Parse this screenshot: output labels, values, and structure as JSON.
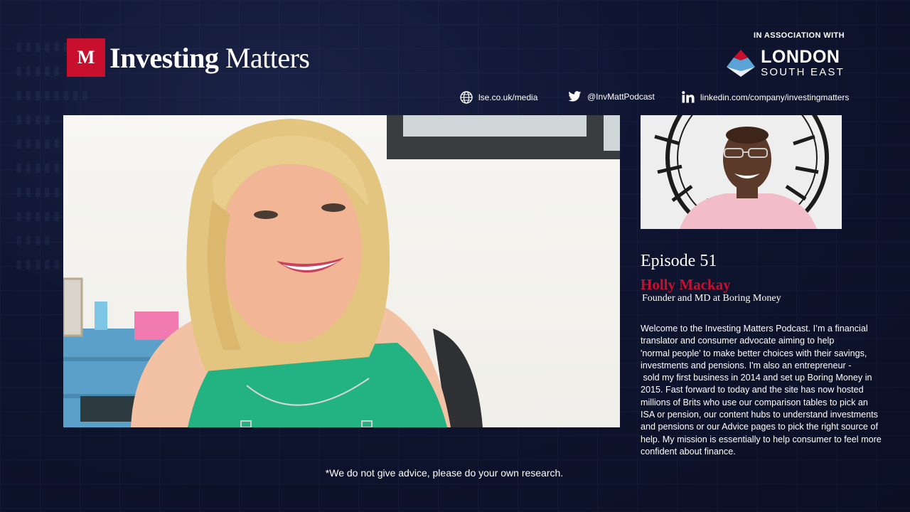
{
  "brand": {
    "logo_letter": "M",
    "name_bold": "Investing",
    "name_regular": "Matters"
  },
  "association": {
    "label": "IN ASSOCIATION WITH",
    "partner_line1": "LONDON",
    "partner_line2": "SOUTH EAST"
  },
  "social": {
    "website": "lse.co.uk/media",
    "twitter": "@InvMattPodcast",
    "linkedin": "linkedin.com/company/investingmatters"
  },
  "episode": {
    "title": "Episode 51",
    "guest_name": "Holly Mackay",
    "guest_role": "Founder and MD at Boring Money",
    "bio_lines": [
      "Welcome to the Investing Matters Podcast. I’m a financial",
      "translator and consumer advocate aiming to help",
      "'normal people' to make better choices with their savings,",
      "investments and pensions. I'm also an entrepreneur -",
      " sold my first business in 2014 and set up Boring Money in",
      "2015. Fast forward to today and the site has now hosted",
      "millions of Brits who use our comparison tables to pick an",
      "ISA or pension, our content hubs to understand investments",
      "and pensions or our Advice pages to pick the right source of",
      "help. My mission is essentially to help consumer to feel more",
      "confident about finance."
    ]
  },
  "disclaimer": "*We do not give advice, please do your own research.",
  "colors": {
    "accent": "#c8102e",
    "background": "#0f1530",
    "partner_top": "#c8102e",
    "partner_mid": "#5aa3d6"
  }
}
